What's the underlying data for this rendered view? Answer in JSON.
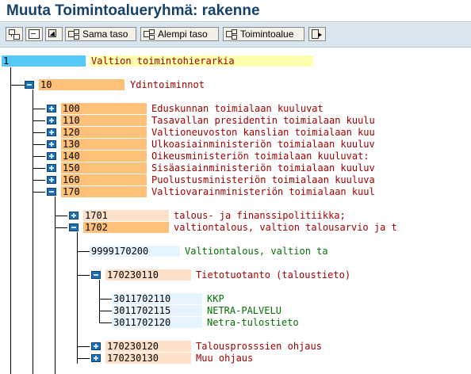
{
  "title": "Muuta Toimintoalueryhmä: rakenne",
  "toolbar": {
    "buttons": [
      {
        "label": "",
        "icon": "expand-tree-icon"
      },
      {
        "label": "",
        "icon": "collapse-tree-icon"
      },
      {
        "label": "",
        "icon": "select-cursor-icon"
      },
      {
        "label": "Sama taso",
        "icon": "node-icon"
      },
      {
        "label": "Alempi taso",
        "icon": "node-icon"
      },
      {
        "label": "Toimintoalue",
        "icon": "node-icon"
      },
      {
        "label": "",
        "icon": "cut-icon"
      }
    ]
  },
  "tree": {
    "root": {
      "code": "1",
      "text": "Valtion toimintohierarkia"
    },
    "level1": {
      "code": "10",
      "text": "Ydintoiminnot"
    },
    "level2": [
      {
        "code": "100",
        "text": "Eduskunnan toimialaan kuuluvat"
      },
      {
        "code": "110",
        "text": "Tasavallan presidentin toimialaan kuuluva"
      },
      {
        "code": "120",
        "text": "Valtioneuvoston kanslian toimialaan kuul"
      },
      {
        "code": "130",
        "text": "Ulkoasiainministeriön toimialaan kuuluva"
      },
      {
        "code": "140",
        "text": "Oikeusministeriön toimialaan kuuluvat:"
      },
      {
        "code": "150",
        "text": "Sisäasiainministeriön toimialaan kuuluva"
      },
      {
        "code": "160",
        "text": "Puolustusministeriön toimialaan kuuluvat"
      },
      {
        "code": "170",
        "text": "Valtiovarainministeriön toimialaan kuulu"
      }
    ],
    "level3": [
      {
        "code": "1701",
        "text": "talous- ja finanssipolitiikka;"
      },
      {
        "code": "1702",
        "text": "valtiontalous, valtion talousarvio ja ta"
      }
    ],
    "level4": {
      "code": "9999170200",
      "text": "Valtiontalous, valtion ta"
    },
    "level5": [
      {
        "code": "170230110",
        "text": "Tietotuotanto (taloustieto)"
      },
      {
        "code": "170230120",
        "text": "Talousprosssien ohjaus"
      },
      {
        "code": "170230130",
        "text": "Muu ohjaus"
      }
    ],
    "level6": [
      {
        "code": "3011702110",
        "text": "KKP"
      },
      {
        "code": "3011702115",
        "text": "NETRA-PALVELU"
      },
      {
        "code": "3011702120",
        "text": "Netra-tulostieto"
      }
    ]
  },
  "colors": {
    "root_code_bg": "#55c8f5",
    "root_text_bg": "#ffffb0",
    "code_bg": "#ffc07a",
    "code_bg_light": "#fde0c8",
    "leaf_code_bg": "#e6f4ff",
    "text_red": "#a00000",
    "text_green": "#007000",
    "folder_icon": "#1d6fb8"
  }
}
